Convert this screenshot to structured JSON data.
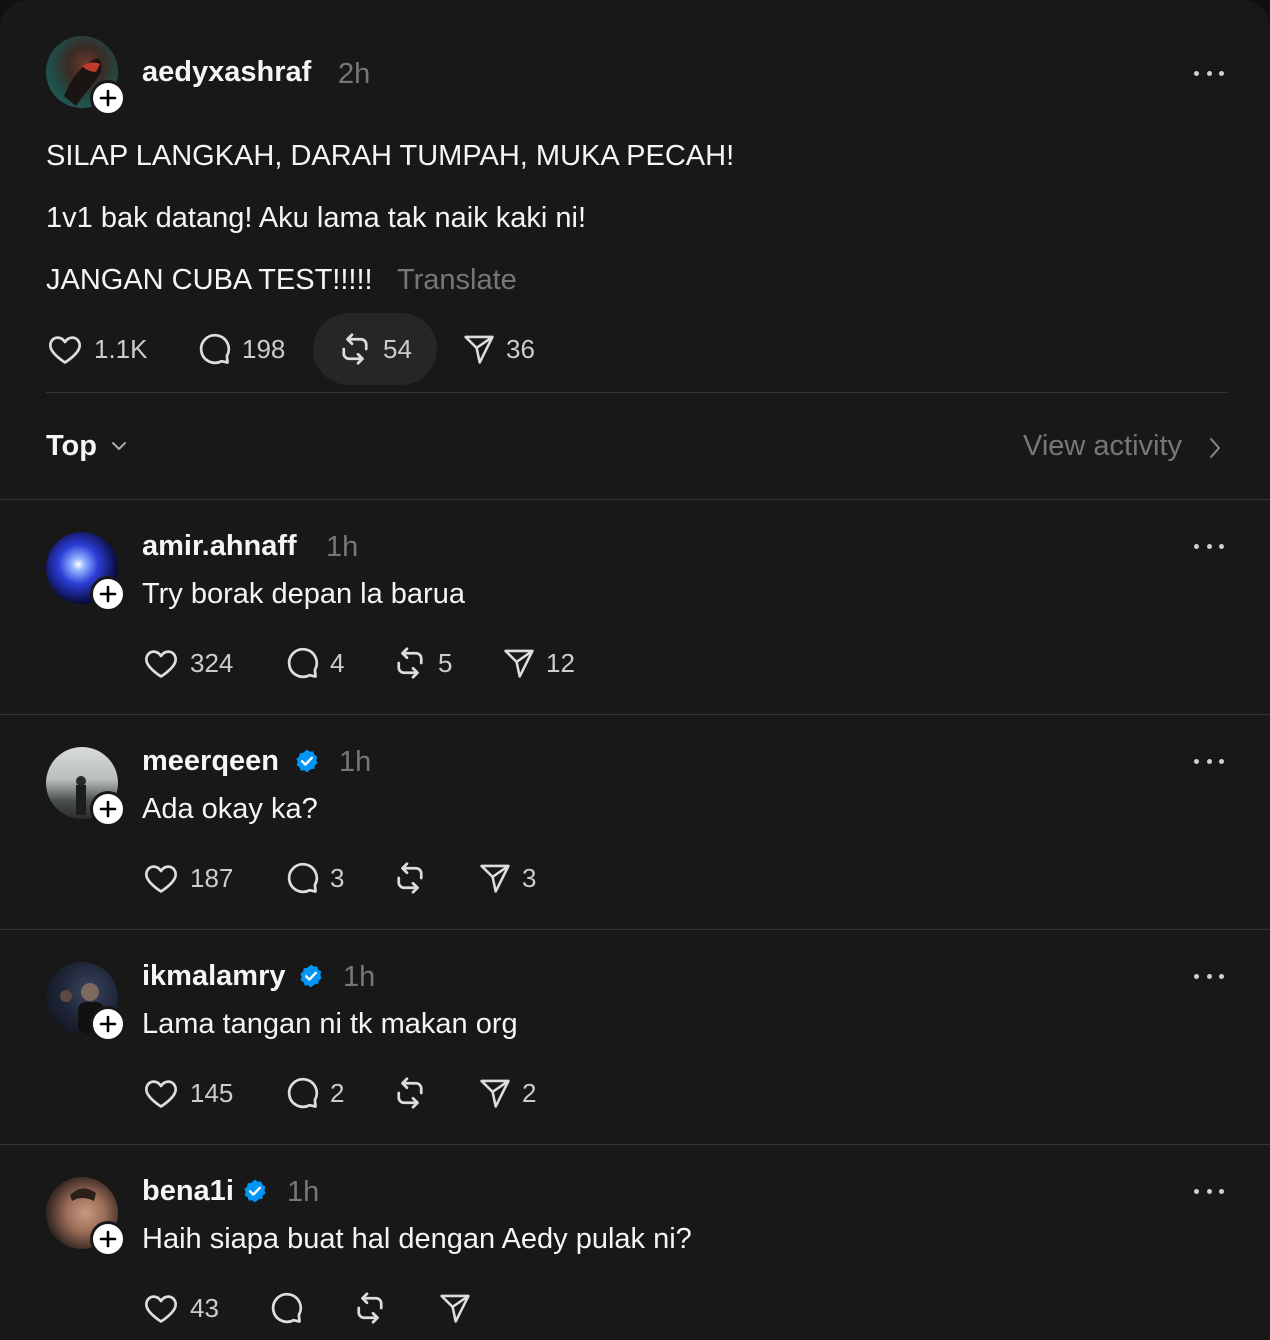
{
  "post": {
    "username": "aedyxashraf",
    "time": "2h",
    "lines": [
      "SILAP LANGKAH, DARAH TUMPAH, MUKA PECAH!",
      "1v1 bak datang! Aku lama tak naik kaki ni!",
      "JANGAN CUBA TEST!!!!!"
    ],
    "translate_label": "Translate",
    "likes": "1.1K",
    "replies": "198",
    "reposts": "54",
    "shares": "36"
  },
  "sort": {
    "label": "Top",
    "view_activity": "View activity"
  },
  "comments": [
    {
      "username": "amir.ahnaff",
      "time": "1h",
      "text": "Try borak depan la barua",
      "likes": "324",
      "replies": "4",
      "reposts": "5",
      "shares": "12",
      "verified": false
    },
    {
      "username": "meerqeen",
      "time": "1h",
      "text": "Ada okay ka?",
      "likes": "187",
      "replies": "3",
      "reposts": "",
      "shares": "3",
      "verified": true
    },
    {
      "username": "ikmalamry",
      "time": "1h",
      "text": "Lama tangan ni tk makan org",
      "likes": "145",
      "replies": "2",
      "reposts": "",
      "shares": "2",
      "verified": true
    },
    {
      "username": "bena1i",
      "time": "1h",
      "text": "Haih siapa buat hal dengan Aedy pulak ni?",
      "likes": "43",
      "replies": "",
      "reposts": "",
      "shares": "",
      "verified": true
    }
  ],
  "icons": {
    "like": "heart-icon",
    "reply": "comment-bubble-icon",
    "repost": "repost-icon",
    "share": "paper-plane-icon",
    "more": "more-dots-icon",
    "follow": "plus-icon",
    "verified": "verified-badge-icon"
  },
  "colors": {
    "background": "#181818",
    "text": "#f3f5f7",
    "muted": "#777777",
    "verified": "#0095f6"
  }
}
